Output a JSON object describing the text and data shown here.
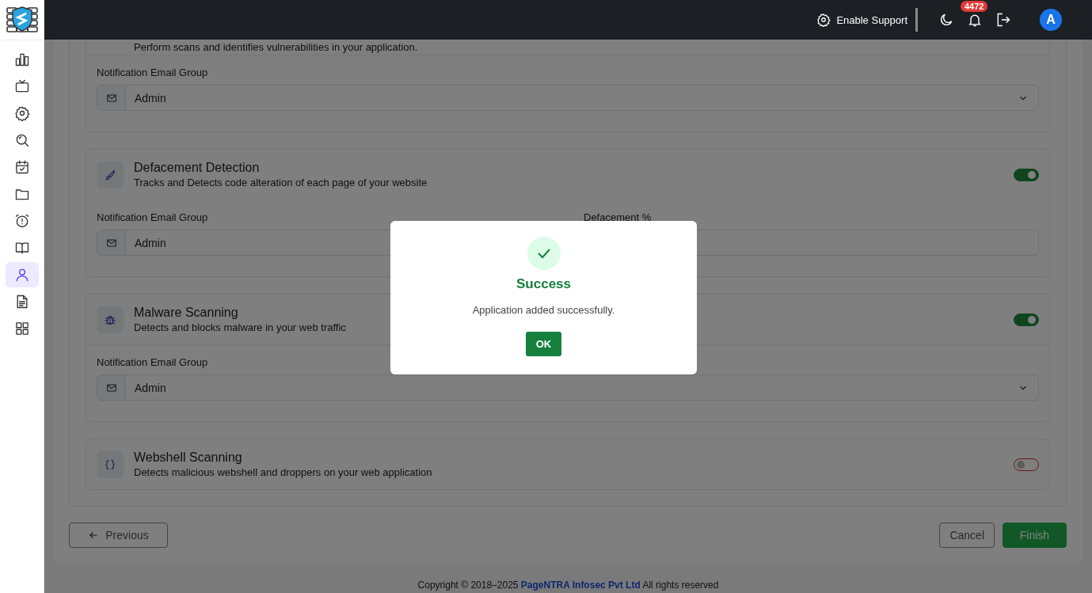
{
  "sidebar": {
    "items": [
      {
        "selected": false
      },
      {
        "selected": false
      },
      {
        "selected": false
      },
      {
        "selected": false
      },
      {
        "selected": false
      },
      {
        "selected": false
      },
      {
        "selected": false
      },
      {
        "selected": false
      },
      {
        "selected": true
      },
      {
        "selected": false
      },
      {
        "selected": false
      }
    ]
  },
  "header": {
    "support_label": "Enable Support",
    "notification_count": "4472",
    "avatar_letter": "A"
  },
  "modules": [
    {
      "description": "Perform scans and identifies vulnerabilities in your application.",
      "fields": [
        {
          "kind": "select",
          "label": "Notification Email Group",
          "value": "Admin"
        }
      ]
    },
    {
      "title": "Defacement Detection",
      "description": "Tracks and Detects code alteration of each page of your website",
      "enabled": true,
      "fields": [
        {
          "kind": "select",
          "label": "Notification Email Group",
          "value": "Admin"
        },
        {
          "kind": "input",
          "label": "Defacement %"
        }
      ]
    },
    {
      "title": "Malware Scanning",
      "description": "Detects and blocks malware in your web traffic",
      "enabled": true,
      "fields": [
        {
          "kind": "select",
          "label": "Notification Email Group",
          "value": "Admin"
        }
      ]
    },
    {
      "title": "Webshell Scanning",
      "description": "Detects malicious webshell and droppers on your web application",
      "enabled": false
    }
  ],
  "buttons": {
    "previous": "Previous",
    "cancel": "Cancel",
    "finish": "Finish"
  },
  "footer": {
    "before": "Copyright © 2018–2025",
    "link": "PageNTRA Infosec Pvt Ltd",
    "after": "All rights reserved"
  },
  "dialog": {
    "title": "Success",
    "message": "Application added successfully.",
    "button": "OK"
  }
}
